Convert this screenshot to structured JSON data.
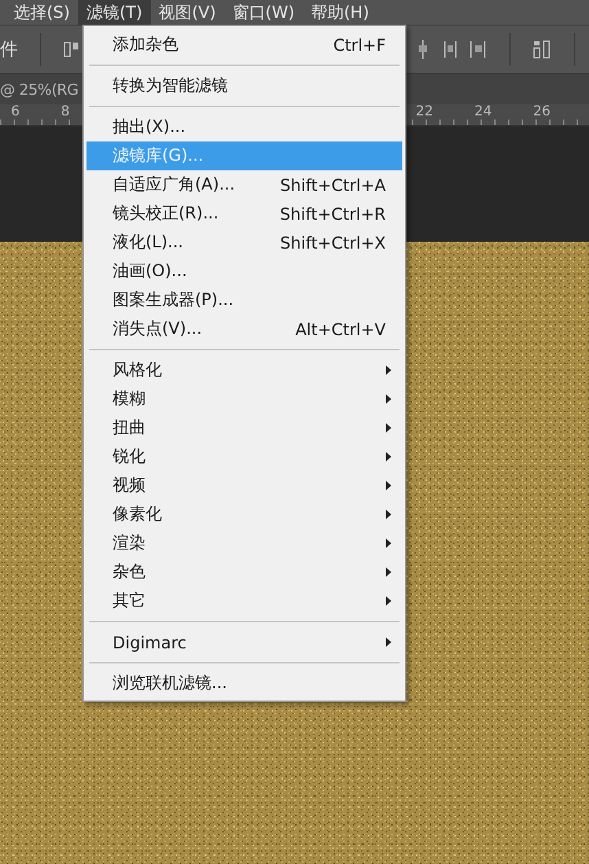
{
  "menubar": [
    {
      "label": "选择(S)",
      "selected": false
    },
    {
      "label": "滤镜(T)",
      "selected": true
    },
    {
      "label": "视图(V)",
      "selected": false
    },
    {
      "label": "窗口(W)",
      "selected": false
    },
    {
      "label": "帮助(H)",
      "selected": false
    }
  ],
  "options_bar": {
    "label": "件"
  },
  "document_tab": {
    "title": "@ 25%(RG"
  },
  "ruler": {
    "left_labels": [
      "6",
      "8"
    ],
    "right_labels": [
      "22",
      "24",
      "26"
    ]
  },
  "menu": {
    "items": [
      {
        "kind": "item",
        "label": "添加杂色",
        "shortcut": "Ctrl+F",
        "selected": false
      },
      {
        "kind": "separator"
      },
      {
        "kind": "item",
        "label": "转换为智能滤镜",
        "selected": false
      },
      {
        "kind": "separator"
      },
      {
        "kind": "item",
        "label": "抽出(X)...",
        "selected": false
      },
      {
        "kind": "item",
        "label": "滤镜库(G)...",
        "selected": true
      },
      {
        "kind": "item",
        "label": "自适应广角(A)...",
        "shortcut": "Shift+Ctrl+A",
        "selected": false
      },
      {
        "kind": "item",
        "label": "镜头校正(R)...",
        "shortcut": "Shift+Ctrl+R",
        "selected": false
      },
      {
        "kind": "item",
        "label": "液化(L)...",
        "shortcut": "Shift+Ctrl+X",
        "selected": false
      },
      {
        "kind": "item",
        "label": "油画(O)...",
        "selected": false
      },
      {
        "kind": "item",
        "label": "图案生成器(P)...",
        "selected": false
      },
      {
        "kind": "item",
        "label": "消失点(V)...",
        "shortcut": "Alt+Ctrl+V",
        "selected": false
      },
      {
        "kind": "separator"
      },
      {
        "kind": "submenu",
        "label": "风格化",
        "selected": false
      },
      {
        "kind": "submenu",
        "label": "模糊",
        "selected": false
      },
      {
        "kind": "submenu",
        "label": "扭曲",
        "selected": false
      },
      {
        "kind": "submenu",
        "label": "锐化",
        "selected": false
      },
      {
        "kind": "submenu",
        "label": "视频",
        "selected": false
      },
      {
        "kind": "submenu",
        "label": "像素化",
        "selected": false
      },
      {
        "kind": "submenu",
        "label": "渲染",
        "selected": false
      },
      {
        "kind": "submenu",
        "label": "杂色",
        "selected": false
      },
      {
        "kind": "submenu",
        "label": "其它",
        "selected": false
      },
      {
        "kind": "separator"
      },
      {
        "kind": "submenu",
        "label": "Digimarc",
        "selected": false
      },
      {
        "kind": "separator"
      },
      {
        "kind": "item",
        "label": "浏览联机滤镜...",
        "selected": false
      }
    ]
  }
}
